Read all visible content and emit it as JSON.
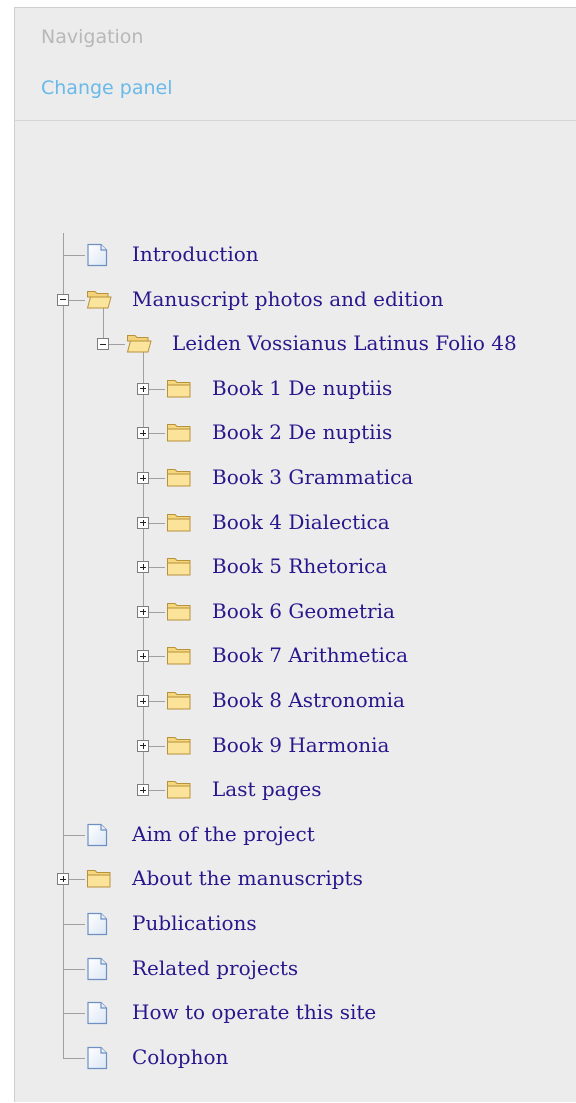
{
  "header": {
    "title": "Navigation",
    "change_panel": "Change panel"
  },
  "tree": {
    "items": [
      {
        "label": "Introduction",
        "type": "page",
        "level": 0,
        "toggle": null
      },
      {
        "label": "Manuscript photos and edition",
        "type": "folder-open",
        "level": 0,
        "toggle": "minus"
      },
      {
        "label": "Leiden Vossianus Latinus Folio 48",
        "type": "folder-open",
        "level": 1,
        "toggle": "minus"
      },
      {
        "label": "Book 1 De nuptiis",
        "type": "folder",
        "level": 2,
        "toggle": "plus"
      },
      {
        "label": "Book 2 De nuptiis",
        "type": "folder",
        "level": 2,
        "toggle": "plus"
      },
      {
        "label": "Book 3 Grammatica",
        "type": "folder",
        "level": 2,
        "toggle": "plus"
      },
      {
        "label": "Book 4 Dialectica",
        "type": "folder",
        "level": 2,
        "toggle": "plus"
      },
      {
        "label": "Book 5 Rhetorica",
        "type": "folder",
        "level": 2,
        "toggle": "plus"
      },
      {
        "label": "Book 6 Geometria",
        "type": "folder",
        "level": 2,
        "toggle": "plus"
      },
      {
        "label": "Book 7 Arithmetica",
        "type": "folder",
        "level": 2,
        "toggle": "plus"
      },
      {
        "label": "Book 8 Astronomia",
        "type": "folder",
        "level": 2,
        "toggle": "plus"
      },
      {
        "label": "Book 9 Harmonia",
        "type": "folder",
        "level": 2,
        "toggle": "plus"
      },
      {
        "label": "Last pages",
        "type": "folder",
        "level": 2,
        "toggle": "plus"
      },
      {
        "label": "Aim of the project",
        "type": "page",
        "level": 0,
        "toggle": null
      },
      {
        "label": "About the manuscripts",
        "type": "folder",
        "level": 0,
        "toggle": "plus"
      },
      {
        "label": "Publications",
        "type": "page",
        "level": 0,
        "toggle": null
      },
      {
        "label": "Related projects",
        "type": "page",
        "level": 0,
        "toggle": null
      },
      {
        "label": "How to operate this site",
        "type": "page",
        "level": 0,
        "toggle": null
      },
      {
        "label": "Colophon",
        "type": "page",
        "level": 0,
        "toggle": null
      }
    ]
  },
  "colors": {
    "link": "#2a168c",
    "accent": "#69b9e9",
    "muted": "#b8b8b8",
    "panel_bg": "#ececec"
  }
}
